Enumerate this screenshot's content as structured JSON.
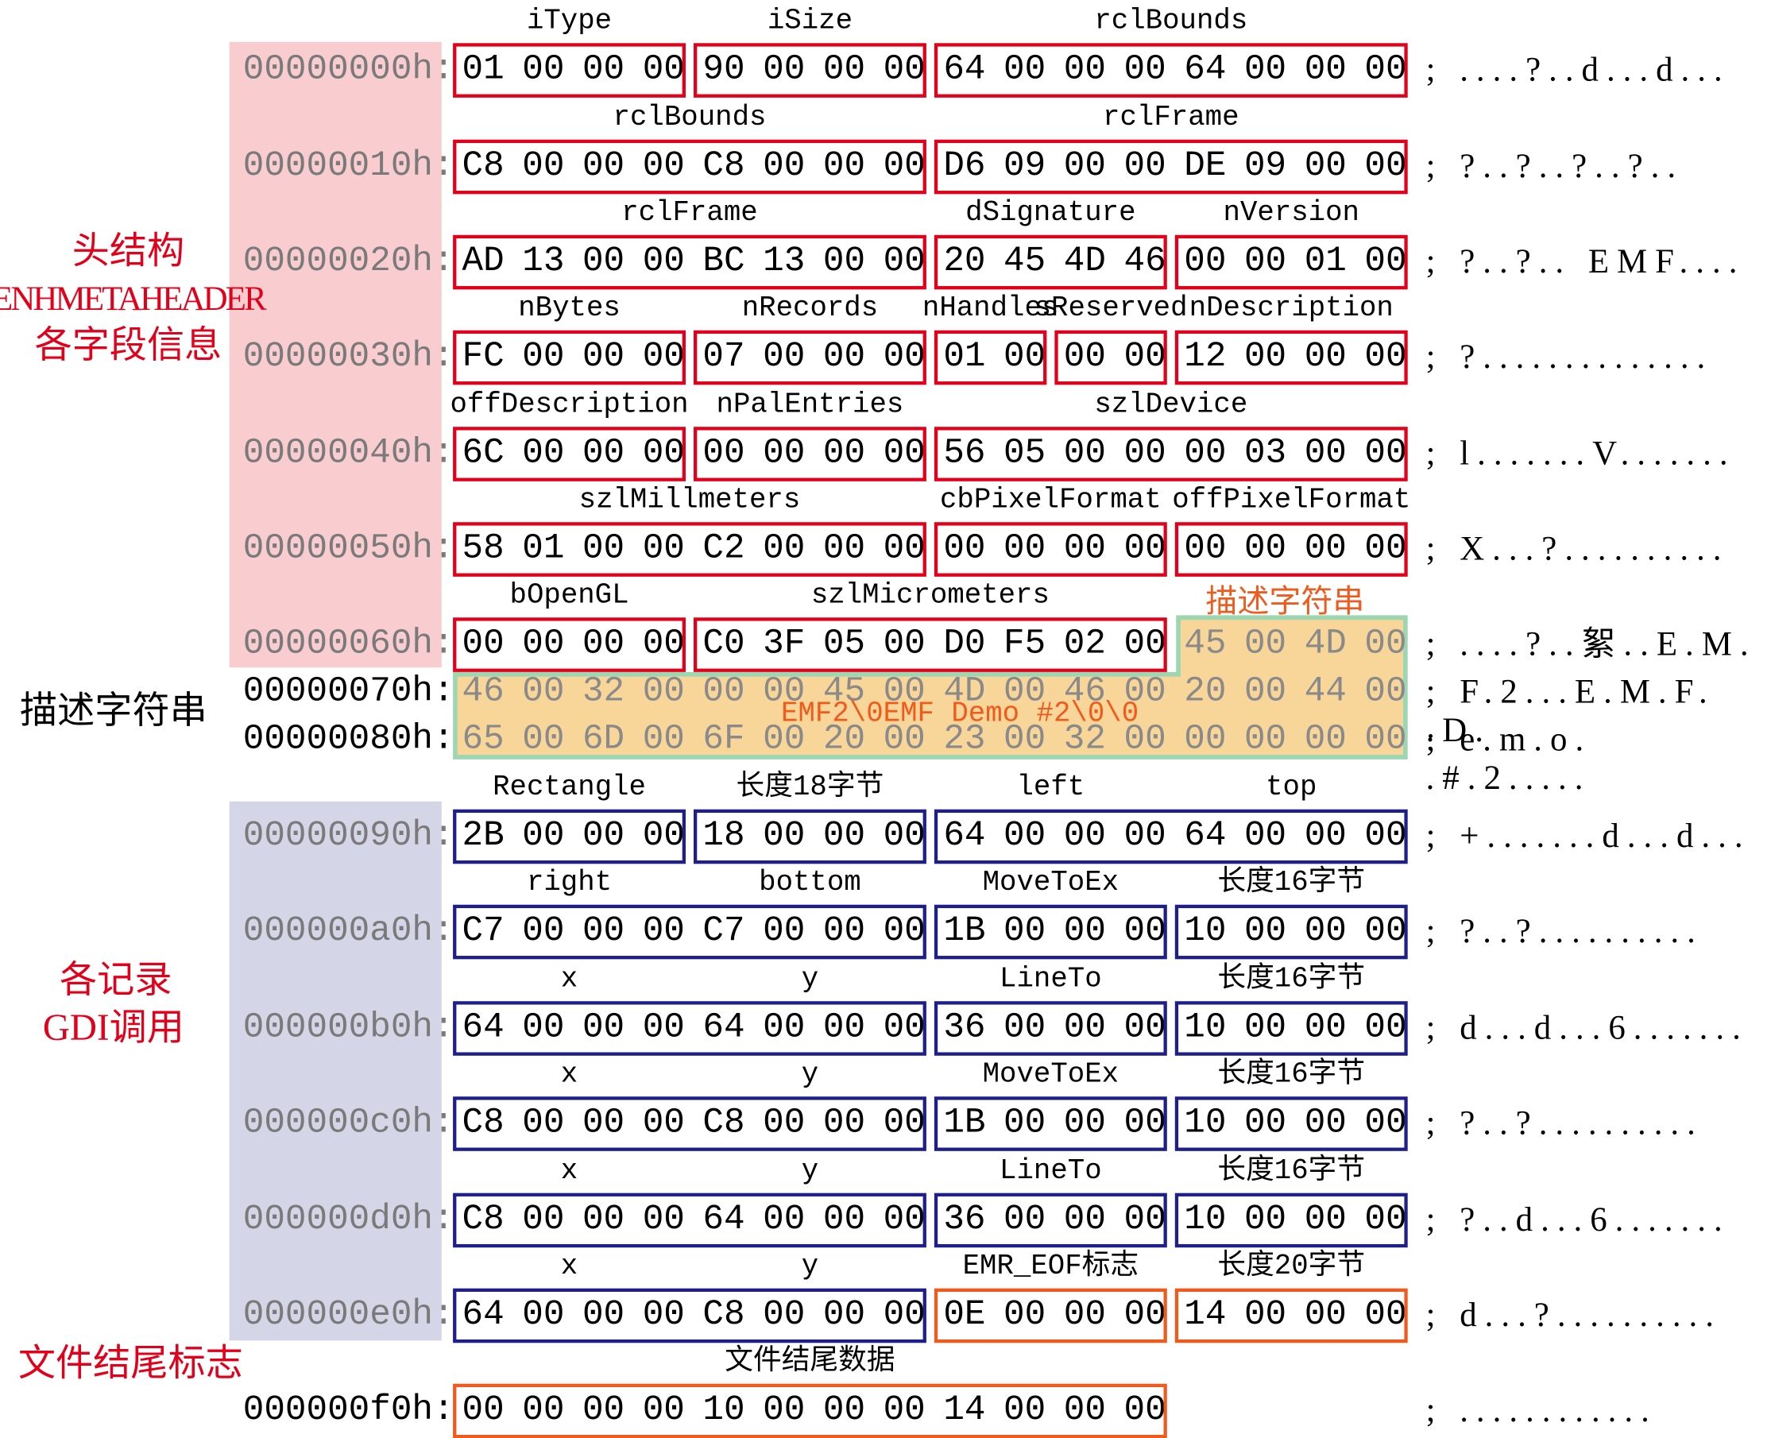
{
  "colors": {
    "header_box": "#e3001b",
    "record_box": "#1f1f8c",
    "eof_box": "#f05a1c",
    "header_panel": "#f9ccd0",
    "record_panel": "#d5d5e8",
    "desc_fill": "#f8d598",
    "desc_border": "#9fd6b2",
    "side_label": "#e3001b",
    "offset_gray": "#7a7a7a"
  },
  "side_labels": [
    {
      "text": "头结构",
      "color": "red"
    },
    {
      "text": "ENHMETAHEADER",
      "color": "red"
    },
    {
      "text": "各字段信息",
      "color": "red"
    },
    {
      "text": "描述字符串",
      "color": "black"
    },
    {
      "text": "各记录",
      "color": "red"
    },
    {
      "text": "GDI调用",
      "color": "red"
    },
    {
      "text": "文件结尾标志",
      "color": "red"
    }
  ],
  "desc_overlay": "EMF2\\0EMF Demo #2\\0\\0",
  "desc_label": "描述字符串",
  "rows": [
    {
      "offset": "00000000h:",
      "bytes": "01 00 00 00 90 00 00 00 64 00 00 00 64 00 00 00",
      "ascii": "; ....?..d...d...",
      "zone": "header"
    },
    {
      "offset": "00000010h:",
      "bytes": "C8 00 00 00 C8 00 00 00 D6 09 00 00 DE 09 00 00",
      "ascii": "; ?..?..?..?..",
      "zone": "header"
    },
    {
      "offset": "00000020h:",
      "bytes": "AD 13 00 00 BC 13 00 00 20 45 4D 46 00 00 01 00",
      "ascii": "; ?..?.. EMF....",
      "zone": "header"
    },
    {
      "offset": "00000030h:",
      "bytes": "FC 00 00 00 07 00 00 00 01 00 00 00 12 00 00 00",
      "ascii": "; ?..............",
      "zone": "header"
    },
    {
      "offset": "00000040h:",
      "bytes": "6C 00 00 00 00 00 00 00 56 05 00 00 00 03 00 00",
      "ascii": "; l.......V.......",
      "zone": "header"
    },
    {
      "offset": "00000050h:",
      "bytes": "58 01 00 00 C2 00 00 00 00 00 00 00 00 00 00 00",
      "ascii": "; X...?..........",
      "zone": "header"
    },
    {
      "offset": "00000060h:",
      "bytes": "00 00 00 00 C0 3F 05 00 D0 F5 02 00 45 00 4D 00",
      "ascii": "; ....?..絮..E.M.",
      "zone": "header"
    },
    {
      "offset": "00000070h:",
      "bytes": "46 00 32 00 00 00 45 00 4D 00 46 00 20 00 44 00",
      "ascii": "; F.2...E.M.F. .D.",
      "zone": "desc"
    },
    {
      "offset": "00000080h:",
      "bytes": "65 00 6D 00 6F 00 20 00 23 00 32 00 00 00 00 00",
      "ascii": "; e.m.o. .#.2.....",
      "zone": "desc"
    },
    {
      "offset": "00000090h:",
      "bytes": "2B 00 00 00 18 00 00 00 64 00 00 00 64 00 00 00",
      "ascii": "; +.......d...d...",
      "zone": "record"
    },
    {
      "offset": "000000a0h:",
      "bytes": "C7 00 00 00 C7 00 00 00 1B 00 00 00 10 00 00 00",
      "ascii": "; ?..?..........",
      "zone": "record"
    },
    {
      "offset": "000000b0h:",
      "bytes": "64 00 00 00 64 00 00 00 36 00 00 00 10 00 00 00",
      "ascii": "; d...d...6.......",
      "zone": "record"
    },
    {
      "offset": "000000c0h:",
      "bytes": "C8 00 00 00 C8 00 00 00 1B 00 00 00 10 00 00 00",
      "ascii": "; ?..?..........",
      "zone": "record"
    },
    {
      "offset": "000000d0h:",
      "bytes": "C8 00 00 00 64 00 00 00 36 00 00 00 10 00 00 00",
      "ascii": "; ?..d...6.......",
      "zone": "record"
    },
    {
      "offset": "000000e0h:",
      "bytes": "64 00 00 00 C8 00 00 00 0E 00 00 00 14 00 00 00",
      "ascii": "; d...?..........",
      "zone": "record"
    },
    {
      "offset": "000000f0h:",
      "bytes": "00 00 00 00 10 00 00 00 14 00 00 00",
      "ascii": "; ............",
      "zone": "tail"
    }
  ],
  "boxes": [
    [
      0,
      0,
      4,
      "header_box"
    ],
    [
      0,
      4,
      4,
      "header_box"
    ],
    [
      0,
      8,
      8,
      "header_box"
    ],
    [
      1,
      0,
      8,
      "header_box"
    ],
    [
      1,
      8,
      8,
      "header_box"
    ],
    [
      2,
      0,
      8,
      "header_box"
    ],
    [
      2,
      8,
      4,
      "header_box"
    ],
    [
      2,
      12,
      4,
      "header_box"
    ],
    [
      3,
      0,
      4,
      "header_box"
    ],
    [
      3,
      4,
      4,
      "header_box"
    ],
    [
      3,
      8,
      2,
      "header_box"
    ],
    [
      3,
      10,
      2,
      "header_box"
    ],
    [
      3,
      12,
      4,
      "header_box"
    ],
    [
      4,
      0,
      4,
      "header_box"
    ],
    [
      4,
      4,
      4,
      "header_box"
    ],
    [
      4,
      8,
      8,
      "header_box"
    ],
    [
      5,
      0,
      8,
      "header_box"
    ],
    [
      5,
      8,
      4,
      "header_box"
    ],
    [
      5,
      12,
      4,
      "header_box"
    ],
    [
      6,
      0,
      4,
      "header_box"
    ],
    [
      6,
      4,
      8,
      "header_box"
    ],
    [
      9,
      0,
      4,
      "record_box"
    ],
    [
      9,
      4,
      4,
      "record_box"
    ],
    [
      9,
      8,
      8,
      "record_box"
    ],
    [
      10,
      0,
      8,
      "record_box"
    ],
    [
      10,
      8,
      4,
      "record_box"
    ],
    [
      10,
      12,
      4,
      "record_box"
    ],
    [
      11,
      0,
      8,
      "record_box"
    ],
    [
      11,
      8,
      4,
      "record_box"
    ],
    [
      11,
      12,
      4,
      "record_box"
    ],
    [
      12,
      0,
      8,
      "record_box"
    ],
    [
      12,
      8,
      4,
      "record_box"
    ],
    [
      12,
      12,
      4,
      "record_box"
    ],
    [
      13,
      0,
      8,
      "record_box"
    ],
    [
      13,
      8,
      4,
      "record_box"
    ],
    [
      13,
      12,
      4,
      "record_box"
    ],
    [
      14,
      0,
      8,
      "record_box"
    ],
    [
      14,
      8,
      4,
      "eof_box"
    ],
    [
      14,
      12,
      4,
      "eof_box"
    ],
    [
      15,
      0,
      12,
      "eof_box"
    ]
  ],
  "field_labels": [
    [
      0,
      0,
      4,
      "iType"
    ],
    [
      0,
      4,
      4,
      "iSize"
    ],
    [
      0,
      8,
      8,
      "rclBounds"
    ],
    [
      1,
      0,
      8,
      "rclBounds"
    ],
    [
      1,
      8,
      8,
      "rclFrame"
    ],
    [
      2,
      0,
      8,
      "rclFrame"
    ],
    [
      2,
      8,
      4,
      "dSignature"
    ],
    [
      2,
      12,
      4,
      "nVersion"
    ],
    [
      3,
      0,
      4,
      "nBytes"
    ],
    [
      3,
      4,
      4,
      "nRecords"
    ],
    [
      3,
      8,
      2,
      "nHandles"
    ],
    [
      3,
      10,
      2,
      "sReserved"
    ],
    [
      3,
      12,
      4,
      "nDescription"
    ],
    [
      4,
      0,
      4,
      "offDescription"
    ],
    [
      4,
      4,
      4,
      "nPalEntries"
    ],
    [
      4,
      8,
      8,
      "szlDevice"
    ],
    [
      5,
      0,
      8,
      "szlMillmeters"
    ],
    [
      5,
      8,
      4,
      "cbPixelFormat"
    ],
    [
      5,
      12,
      4,
      "offPixelFormat"
    ],
    [
      6,
      0,
      4,
      "bOpenGL"
    ],
    [
      6,
      4,
      8,
      "szlMicrometers"
    ],
    [
      9,
      0,
      4,
      "Rectangle"
    ],
    [
      9,
      4,
      4,
      "长度18字节"
    ],
    [
      9,
      8,
      4,
      "left"
    ],
    [
      9,
      12,
      4,
      "top"
    ],
    [
      10,
      0,
      4,
      "right"
    ],
    [
      10,
      4,
      4,
      "bottom"
    ],
    [
      10,
      8,
      4,
      "MoveToEx"
    ],
    [
      10,
      12,
      4,
      "长度16字节"
    ],
    [
      11,
      0,
      4,
      "x"
    ],
    [
      11,
      4,
      4,
      "y"
    ],
    [
      11,
      8,
      4,
      "LineTo"
    ],
    [
      11,
      12,
      4,
      "长度16字节"
    ],
    [
      12,
      0,
      4,
      "x"
    ],
    [
      12,
      4,
      4,
      "y"
    ],
    [
      12,
      8,
      4,
      "MoveToEx"
    ],
    [
      12,
      12,
      4,
      "长度16字节"
    ],
    [
      13,
      0,
      4,
      "x"
    ],
    [
      13,
      4,
      4,
      "y"
    ],
    [
      13,
      8,
      4,
      "LineTo"
    ],
    [
      13,
      12,
      4,
      "长度16字节"
    ],
    [
      14,
      0,
      4,
      "x"
    ],
    [
      14,
      4,
      4,
      "y"
    ],
    [
      14,
      8,
      4,
      "EMR_EOF标志"
    ],
    [
      14,
      12,
      4,
      "长度20字节"
    ],
    [
      15,
      0,
      12,
      "文件结尾数据"
    ]
  ]
}
